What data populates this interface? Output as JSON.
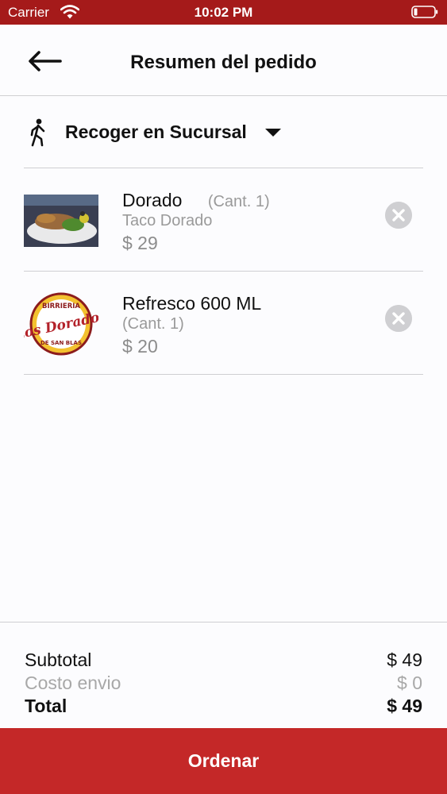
{
  "status_bar": {
    "carrier": "Carrier",
    "time": "10:02 PM"
  },
  "header": {
    "title": "Resumen del pedido",
    "back_icon": "arrow-left-icon"
  },
  "pickup": {
    "label": "Recoger en Sucursal",
    "icon": "walking-person-icon"
  },
  "items": [
    {
      "name": "Dorado",
      "qty": "(Cant. 1)",
      "description": "Taco Dorado",
      "price": "$ 29"
    },
    {
      "name": "Refresco 600 ML",
      "qty": "(Cant. 1)",
      "price": "$ 20"
    }
  ],
  "logo": {
    "top": "BIRRIERIA",
    "middle": "Los Dorados",
    "bottom": "DE SAN BLAS"
  },
  "totals": {
    "subtotal_label": "Subtotal",
    "subtotal_value": "$ 49",
    "shipping_label": "Costo envio",
    "shipping_value": "$ 0",
    "total_label": "Total",
    "total_value": "$ 49"
  },
  "order_button": {
    "label": "Ordenar"
  },
  "colors": {
    "status_bar": "#a51a1a",
    "primary": "#c42828",
    "muted": "#9a9a9a",
    "divider": "#cfcfd2"
  }
}
